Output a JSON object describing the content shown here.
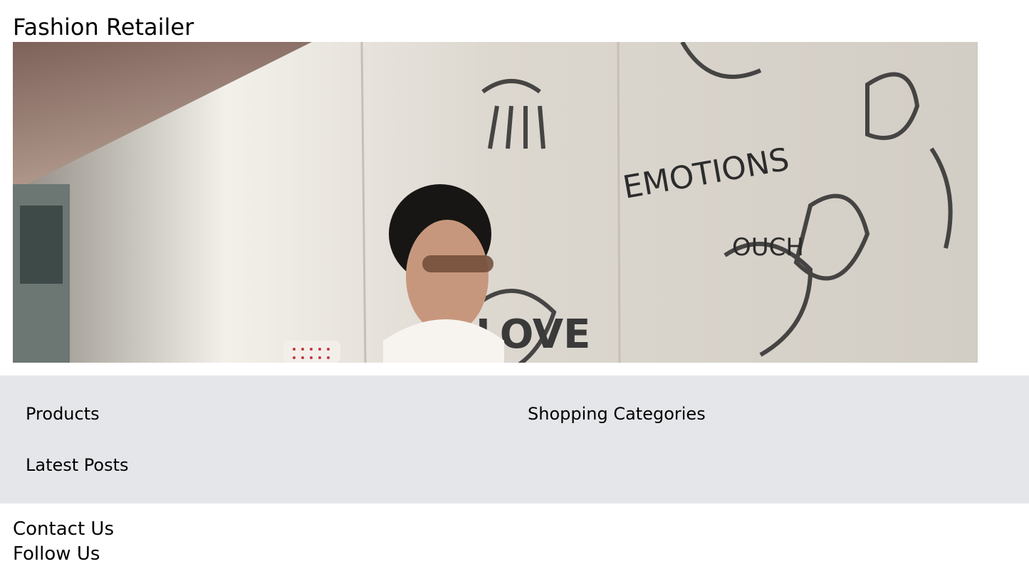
{
  "header": {
    "title": "Fashion Retailer"
  },
  "hero": {
    "image_description": "Woman with sunglasses holding a cup in front of a graffiti wall",
    "wall_words": [
      "EMOTIONS",
      "LOVE",
      "OUCH"
    ]
  },
  "sections": {
    "products": "Products",
    "shopping_categories": "Shopping Categories",
    "latest_posts": "Latest Posts"
  },
  "footer": {
    "contact": "Contact Us",
    "follow": "Follow Us"
  },
  "colors": {
    "band_background": "#e5e6e9",
    "text": "#000000",
    "page_background": "#ffffff"
  }
}
